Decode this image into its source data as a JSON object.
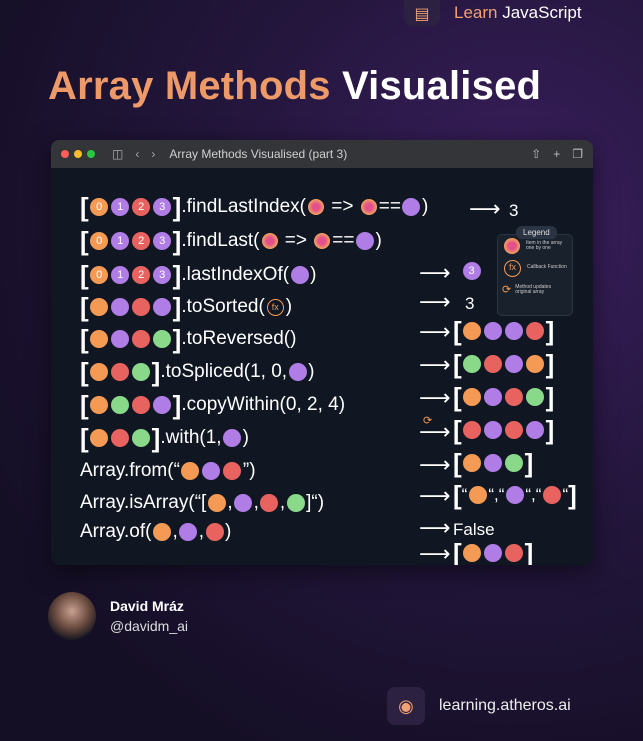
{
  "brand": {
    "prefix": "Learn",
    "name": "JavaScript"
  },
  "headline": {
    "accent": "Array Methods",
    "rest": "Visualised"
  },
  "window": {
    "title": "Array Methods Visualised (part 3)"
  },
  "lines": [
    {
      "method": ".findLastIndex(",
      "result": "3"
    },
    {
      "method": ".findLast(",
      "result": "3"
    },
    {
      "method": ".lastIndexOf(",
      "result": "3"
    },
    {
      "method": ".toSorted("
    },
    {
      "method": ".toReversed()"
    },
    {
      "method": ".toSpliced(1, 0,"
    },
    {
      "method": ".copyWithin(0, 2, 4)"
    },
    {
      "method": ".with(1,"
    },
    {
      "method": "Array.from(“"
    },
    {
      "method": "Array.isArray(“["
    },
    {
      "method": "Array.of("
    }
  ],
  "labels": {
    "arrow_eq": "=>",
    "eq": "==",
    "false": "False",
    "comma": ",",
    "quote": "“",
    "close": ")",
    "open_idx": [
      "0",
      "1",
      "2",
      "3"
    ]
  },
  "legend": {
    "title": "Legend",
    "items": [
      "Item in the array one by one",
      "Callback Function",
      "Method updates original array"
    ]
  },
  "author": {
    "name": "David Mráz",
    "handle": "@davidm_ai"
  },
  "footer": {
    "url": "learning.atheros.ai"
  },
  "colors": {
    "orange": "#f49a54",
    "purple": "#b07ce6",
    "red": "#e8635f",
    "green": "#8ad98a",
    "accent": "#ee9a68"
  }
}
